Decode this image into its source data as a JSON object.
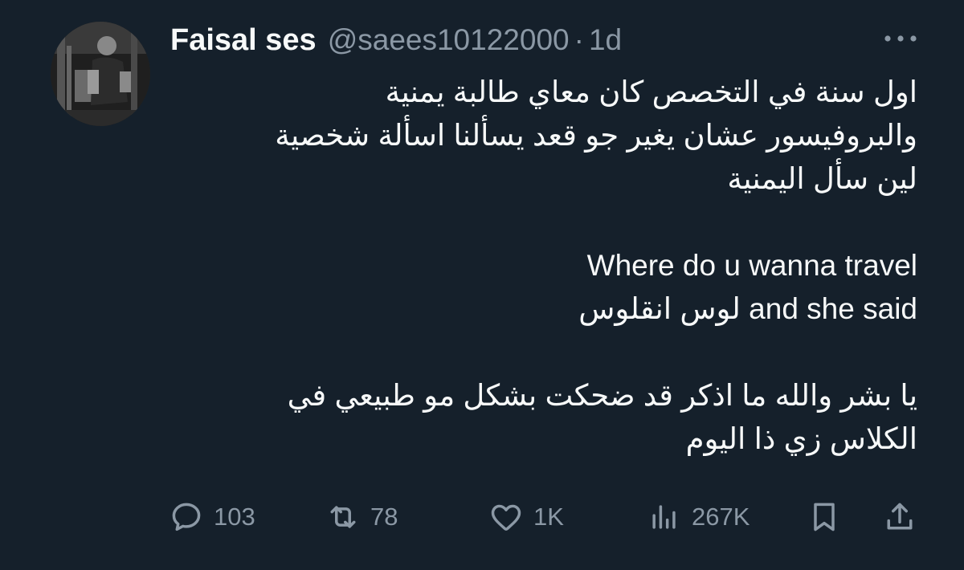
{
  "author": {
    "display_name": "Faisal ses",
    "handle": "@saees10122000",
    "separator": "·",
    "time": "1d"
  },
  "tweet": {
    "lines": [
      "اول سنة في التخصص كان معاي طالبة يمنية",
      "والبروفيسور عشان يغير جو قعد يسألنا اسألة شخصية",
      "لين سأل اليمنية",
      "",
      "Where do u wanna travel",
      "and she said لوس انقلوس",
      "",
      "يا بشر والله ما اذكر قد ضحكت بشكل مو طبيعي في",
      "الكلاس زي ذا اليوم"
    ]
  },
  "actions": {
    "replies": "103",
    "retweets": "78",
    "likes": "1K",
    "views": "267K"
  },
  "icons": {
    "more": "more-horizontal-icon",
    "reply": "reply-icon",
    "retweet": "retweet-icon",
    "like": "heart-icon",
    "views": "views-icon",
    "bookmark": "bookmark-icon",
    "share": "share-icon"
  },
  "colors": {
    "background": "#15202b",
    "text": "#f7f9f9",
    "secondary": "#8b98a5"
  }
}
